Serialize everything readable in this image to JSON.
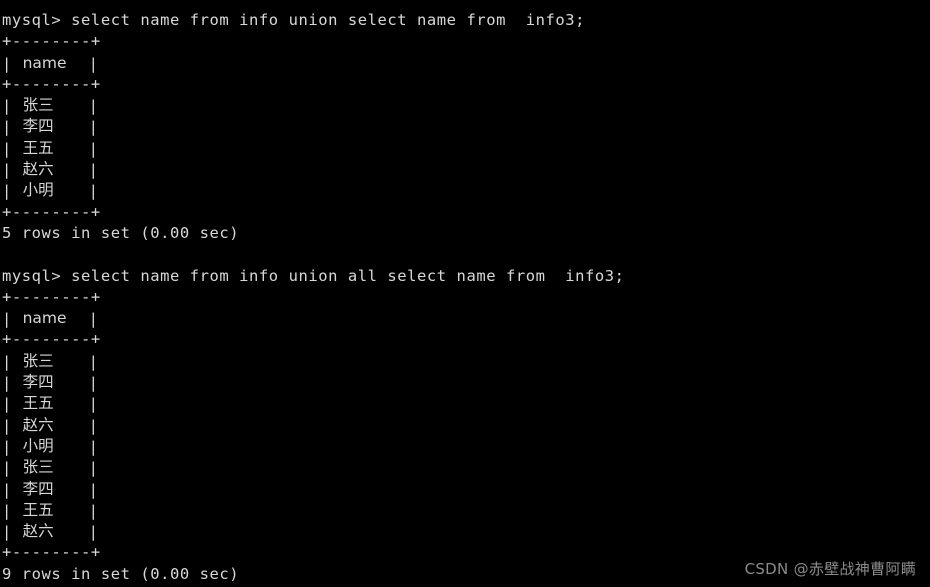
{
  "terminal": {
    "background_color": "#000000",
    "foreground_color": "#d8d8d8",
    "watermark": "CSDN @赤壁战神曹阿瞒",
    "border_row": "+--------+",
    "pipe_left": "|",
    "pipe_right": "|",
    "blocks": [
      {
        "prompt": "mysql> select name from info union select name from  info3;",
        "column_header": "name",
        "rows": [
          "张三",
          "李四",
          "王五",
          "赵六",
          "小明"
        ],
        "status": "5 rows in set (0.00 sec)"
      },
      {
        "prompt": "mysql> select name from info union all select name from  info3;",
        "column_header": "name",
        "rows": [
          "张三",
          "李四",
          "王五",
          "赵六",
          "小明",
          "张三",
          "李四",
          "王五",
          "赵六"
        ],
        "status": "9 rows in set (0.00 sec)"
      }
    ]
  }
}
